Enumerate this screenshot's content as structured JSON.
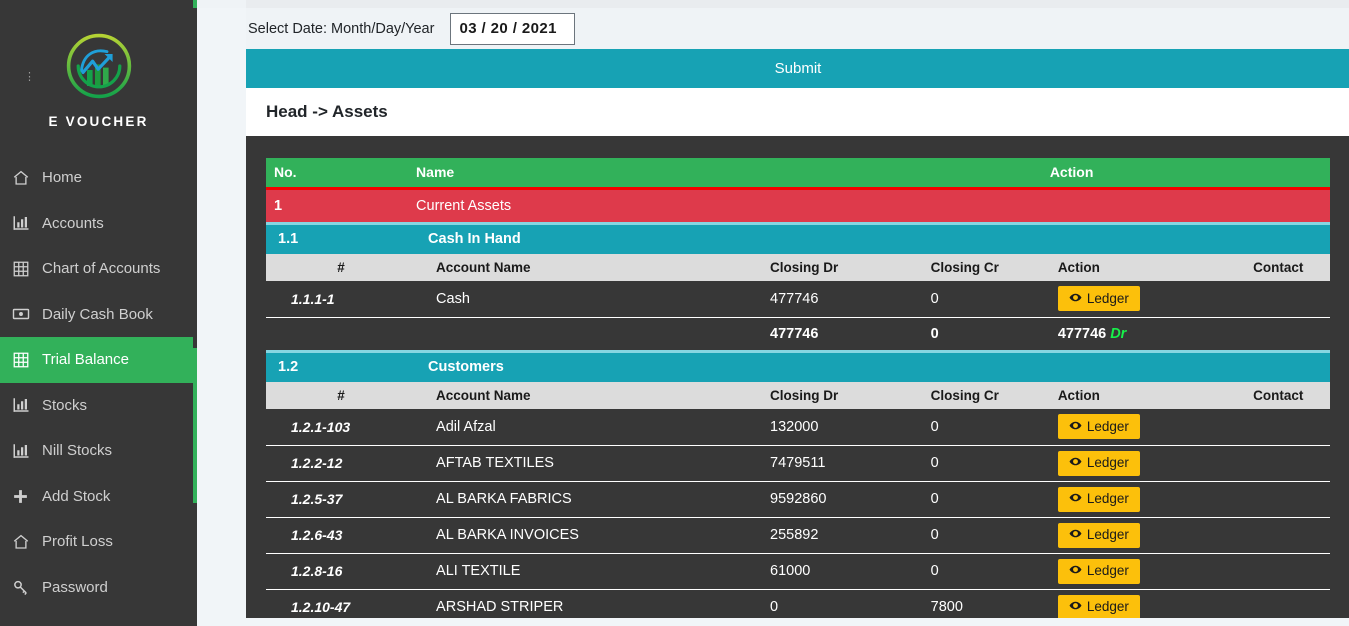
{
  "brand": {
    "name": "E VOUCHER",
    "logo_icon": "evoucher-chart-logo",
    "corner_mark": "⋮"
  },
  "sidebar": {
    "items": [
      {
        "label": "Home",
        "icon": "home-icon",
        "active": false
      },
      {
        "label": "Accounts",
        "icon": "bar-chart-icon",
        "active": false
      },
      {
        "label": "Chart of Accounts",
        "icon": "grid-table-icon",
        "active": false
      },
      {
        "label": "Daily Cash Book",
        "icon": "money-bill-icon",
        "active": false
      },
      {
        "label": "Trial Balance",
        "icon": "grid-table-icon",
        "active": true
      },
      {
        "label": "Stocks",
        "icon": "bar-chart-icon",
        "active": false
      },
      {
        "label": "Nill Stocks",
        "icon": "bar-chart-icon",
        "active": false
      },
      {
        "label": "Add Stock",
        "icon": "plus-icon",
        "active": false
      },
      {
        "label": "Profit Loss",
        "icon": "home-icon",
        "active": false
      },
      {
        "label": "Password",
        "icon": "key-icon",
        "active": false
      }
    ]
  },
  "toolbar": {
    "date_label": "Select Date: Month/Day/Year",
    "date_value": "03 / 20 / 2021",
    "date_placeholder": "mm / dd / yyyy",
    "submit_label": "Submit"
  },
  "page": {
    "title": "Head -> Assets"
  },
  "table": {
    "main_headers": {
      "no": "No.",
      "name": "Name",
      "action": "Action"
    },
    "sub_headers": {
      "hash": "#",
      "account_name": "Account Name",
      "closing_dr": "Closing Dr",
      "closing_cr": "Closing Cr",
      "action": "Action",
      "contact": "Contact"
    },
    "ledger_label": "Ledger",
    "ledger_icon": "eye-icon",
    "groups": [
      {
        "level": 1,
        "no": "1",
        "name": "Current Assets"
      },
      {
        "level": 2,
        "no": "1.1",
        "name": "Cash In Hand"
      }
    ],
    "cash_in_hand_rows": [
      {
        "no": "1.1.1-1",
        "name": "Cash",
        "dr": "477746",
        "cr": "0",
        "contact": ""
      }
    ],
    "cash_in_hand_total": {
      "dr": "477746",
      "cr": "0",
      "balance": "477746",
      "balance_type": "Dr"
    },
    "customers_group": {
      "level": 2,
      "no": "1.2",
      "name": "Customers"
    },
    "customers_rows": [
      {
        "no": "1.2.1-103",
        "name": "Adil Afzal",
        "dr": "132000",
        "cr": "0",
        "contact": ""
      },
      {
        "no": "1.2.2-12",
        "name": "AFTAB TEXTILES",
        "dr": "7479511",
        "cr": "0",
        "contact": ""
      },
      {
        "no": "1.2.5-37",
        "name": "AL BARKA FABRICS",
        "dr": "9592860",
        "cr": "0",
        "contact": ""
      },
      {
        "no": "1.2.6-43",
        "name": "AL BARKA INVOICES",
        "dr": "255892",
        "cr": "0",
        "contact": ""
      },
      {
        "no": "1.2.8-16",
        "name": "ALI TEXTILE",
        "dr": "61000",
        "cr": "0",
        "contact": ""
      },
      {
        "no": "1.2.10-47",
        "name": "ARSHAD STRIPER",
        "dr": "0",
        "cr": "7800",
        "contact": ""
      }
    ]
  },
  "colors": {
    "sidebar_bg": "#373737",
    "accent_green": "#32b15a",
    "teal": "#17a2b4",
    "red": "#de3a4b",
    "amber": "#fcc00b",
    "dr_green": "#17f04a",
    "subheader_gray": "#dcdcdc"
  }
}
